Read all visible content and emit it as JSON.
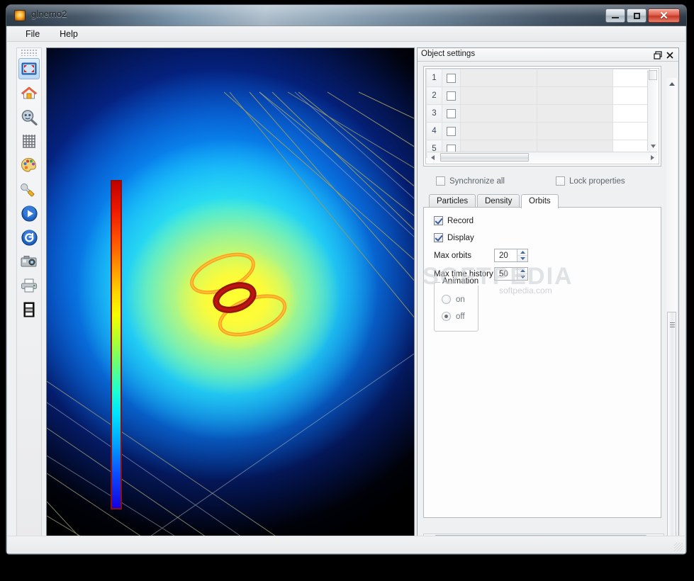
{
  "window": {
    "title": "glnemo2",
    "icon": "app-icon",
    "controls": {
      "minimize": "–",
      "maximize": "❑",
      "close": "✕"
    }
  },
  "menubar": {
    "items": [
      "File",
      "Help"
    ]
  },
  "toolbar": {
    "items": [
      {
        "name": "fullscreen-icon",
        "tip": "Fullscreen",
        "selected": true
      },
      {
        "name": "home-icon",
        "tip": "Reset view",
        "selected": false
      },
      {
        "name": "zoom-icon",
        "tip": "Zoom",
        "selected": false
      },
      {
        "name": "grid-icon",
        "tip": "Grid",
        "selected": false
      },
      {
        "name": "palette-icon",
        "tip": "Colormap",
        "selected": false
      },
      {
        "name": "wrench-icon",
        "tip": "Options",
        "selected": false
      },
      {
        "name": "play-icon",
        "tip": "Play",
        "selected": false
      },
      {
        "name": "reload-icon",
        "tip": "Reload",
        "selected": false
      },
      {
        "name": "camera-icon",
        "tip": "Screenshot",
        "selected": false
      },
      {
        "name": "print-icon",
        "tip": "Print",
        "selected": false
      },
      {
        "name": "filmstrip-icon",
        "tip": "Movie",
        "selected": false
      }
    ]
  },
  "glview": {
    "colorbar": {
      "name": "density-colorbar",
      "stops": [
        "#c00000",
        "#ff5a00",
        "#ffd400",
        "#b4ff2a",
        "#1fffd0",
        "#00a5ff",
        "#1400e0"
      ]
    },
    "axes": [
      {
        "name": "x-axis-arrow",
        "color": "#ee1111"
      },
      {
        "name": "y-axis-arrow",
        "color": "#11dd11"
      },
      {
        "name": "z-axis-arrow",
        "color": "#2233ee"
      }
    ],
    "grid_color": "#9b9b63",
    "orbits_color": "#ff9000"
  },
  "dock": {
    "title": "Object settings",
    "float_button": "❐",
    "close_button": "✕",
    "table": {
      "columns": [
        "",
        "",
        "",
        "",
        ""
      ],
      "rows": [
        {
          "index": "1",
          "checked": false,
          "c1": "",
          "c2": "",
          "c3": ""
        },
        {
          "index": "2",
          "checked": false,
          "c1": "",
          "c2": "",
          "c3": ""
        },
        {
          "index": "3",
          "checked": false,
          "c1": "",
          "c2": "",
          "c3": ""
        },
        {
          "index": "4",
          "checked": false,
          "c1": "",
          "c2": "",
          "c3": ""
        },
        {
          "index": "5",
          "checked": false,
          "c1": "",
          "c2": "",
          "c3": ""
        }
      ]
    },
    "options": {
      "synchronize_all": {
        "label": "Synchronize all",
        "checked": false
      },
      "lock_properties": {
        "label": "Lock properties",
        "checked": false
      }
    },
    "tabs": [
      {
        "label": "Particles",
        "active": false
      },
      {
        "label": "Density",
        "active": false
      },
      {
        "label": "Orbits",
        "active": true
      }
    ],
    "orbits": {
      "record": {
        "label": "Record",
        "checked": true
      },
      "display": {
        "label": "Display",
        "checked": true
      },
      "max_orbits": {
        "label": "Max orbits",
        "value": "20"
      },
      "max_time_history": {
        "label": "Max time history",
        "value": "50"
      },
      "animation": {
        "legend": "Animation",
        "on": {
          "label": "on",
          "selected": false
        },
        "off": {
          "label": "off",
          "selected": true
        }
      }
    }
  },
  "watermark": {
    "top": "SOFTPEDIA",
    "body": "softpedia.com"
  }
}
